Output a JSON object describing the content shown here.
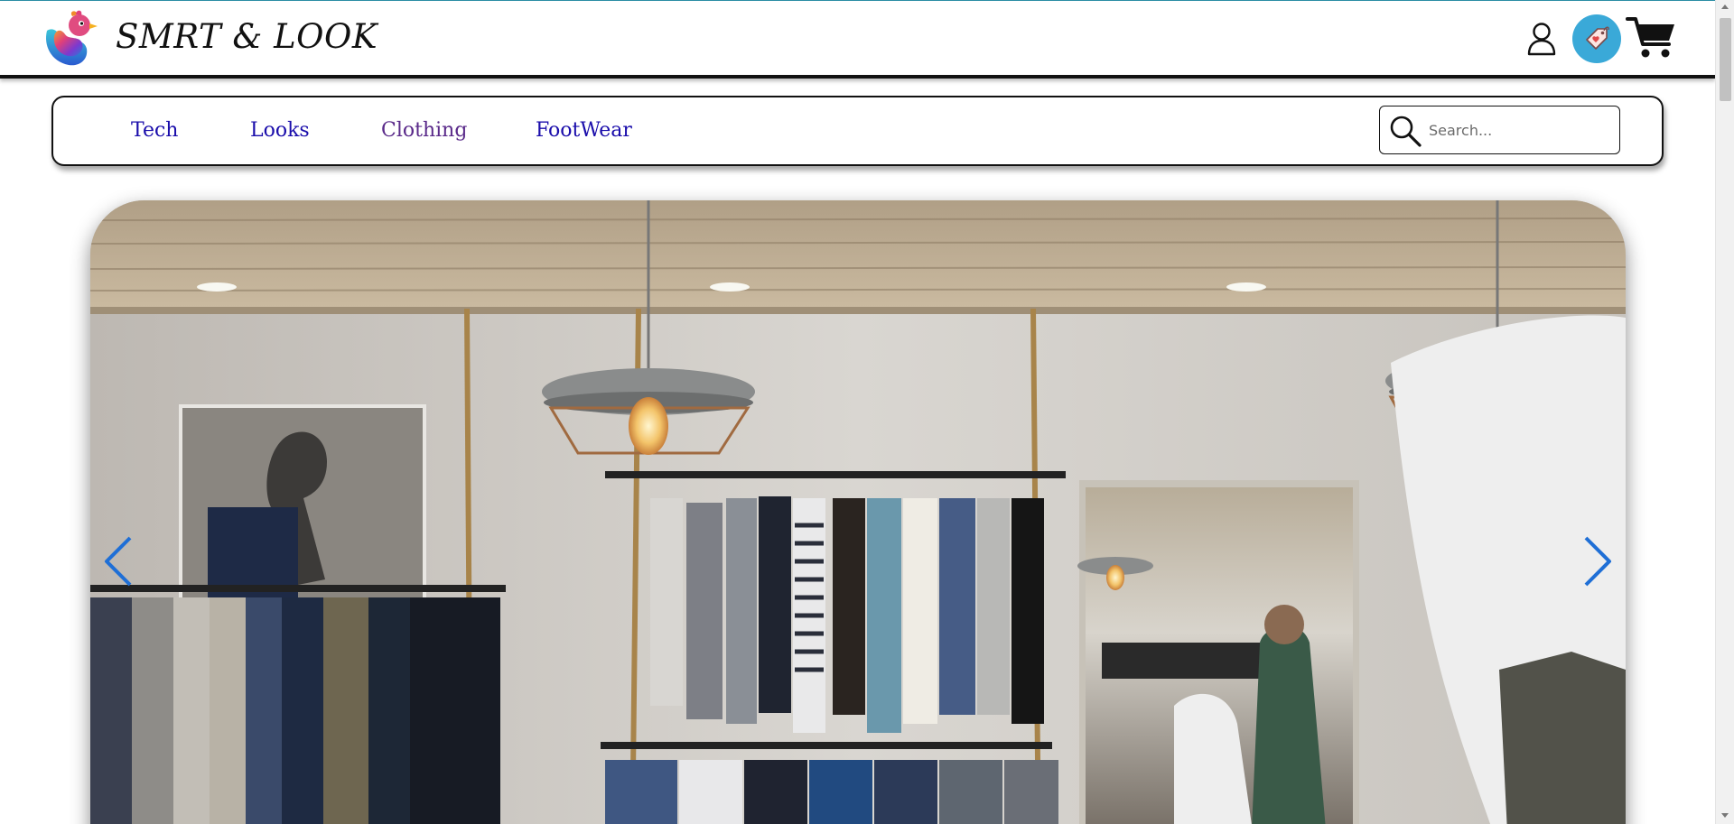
{
  "header": {
    "brand": "SMRT & LOOK",
    "logo_icon": "bird-logo-icon",
    "user_icon": "user-icon",
    "tag_icon": "price-tag-icon",
    "cart_icon": "shopping-cart-icon"
  },
  "nav": {
    "links": [
      {
        "label": "Tech"
      },
      {
        "label": "Looks"
      },
      {
        "label": "Clothing"
      },
      {
        "label": "FootWear"
      }
    ],
    "search": {
      "placeholder": "Search...",
      "value": "",
      "icon": "search-icon"
    }
  },
  "carousel": {
    "image": "clothing-store-interior",
    "prev_icon": "chevron-left-icon",
    "next_icon": "chevron-right-icon"
  },
  "colors": {
    "link": "#1a0dab",
    "link_visited": "#5a2a8a",
    "tag_badge": "#3aa9d8",
    "arrow": "#1f6fd6",
    "top_line": "#2b8fa6"
  }
}
